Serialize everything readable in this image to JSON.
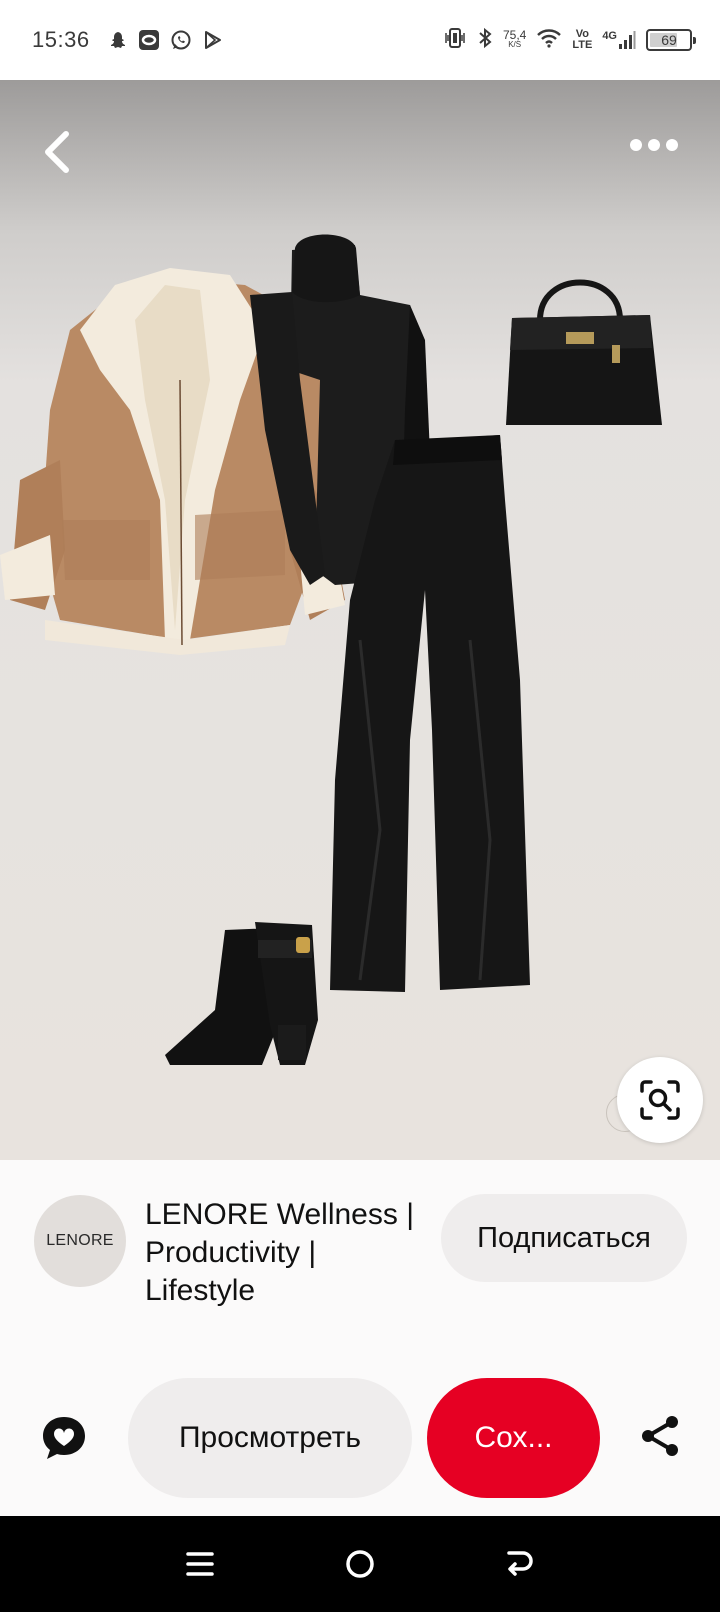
{
  "status_bar": {
    "time": "15:36",
    "net_speed_value": "75,4",
    "net_speed_unit": "K/S",
    "volte_top": "Vo",
    "volte_bottom": "LTE",
    "network_type": "4G",
    "battery_level": "69",
    "app_icons": [
      "snapchat-icon",
      "app-icon",
      "whatsapp-icon",
      "play-store-icon"
    ]
  },
  "pin": {
    "watermark_text": "L",
    "items": [
      "shearling-coat",
      "black-turtleneck",
      "black-handbag",
      "black-leather-pants",
      "black-ankle-boots"
    ],
    "background_color": "#e6e3df"
  },
  "creator": {
    "avatar_text": "LENORE",
    "name": "LENORE Wellness | Productivity | Lifestyle",
    "follow_label": "Подписаться"
  },
  "actions": {
    "visit_label": "Просмотреть",
    "save_label": "Сох...",
    "save_color": "#e60023"
  },
  "nav": {
    "buttons": [
      "menu-icon",
      "home-icon",
      "back-arrow-icon"
    ]
  }
}
